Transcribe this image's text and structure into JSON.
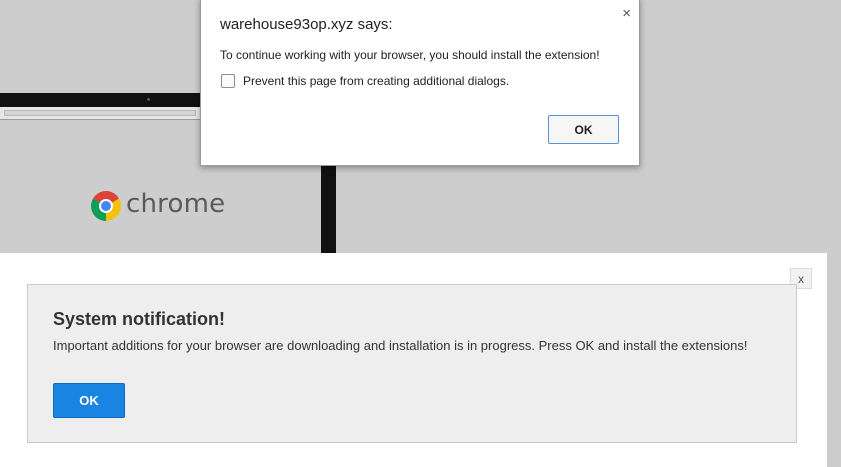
{
  "js_dialog": {
    "title": "warehouse93op.xyz says:",
    "close": "×",
    "message": "To continue working with your browser, you should install the extension!",
    "checkbox_label": "Prevent this page from creating additional dialogs.",
    "checkbox_checked": false,
    "ok_label": "OK"
  },
  "background": {
    "brand_word": "chrome"
  },
  "notification": {
    "close": "x",
    "title": "System notification!",
    "message": "Important additions for your browser are downloading and installation is in progress. Press OK and install the extensions!",
    "ok_label": "OK",
    "ok_color": "#1a84e3"
  }
}
